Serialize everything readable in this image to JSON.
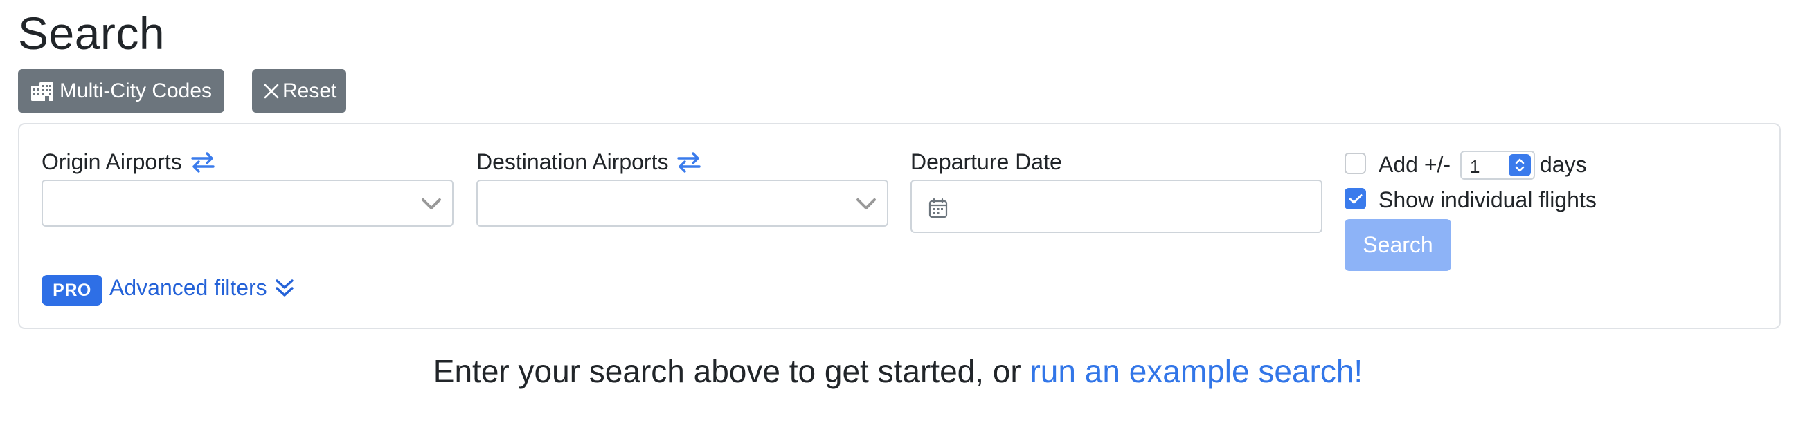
{
  "page": {
    "title": "Search"
  },
  "toolbar": {
    "multi_city_label": "Multi-City Codes",
    "multi_city_icon": "buildings-icon",
    "reset_label": "Reset",
    "reset_icon": "x-icon"
  },
  "form": {
    "origin_label": "Origin Airports",
    "destination_label": "Destination Airports",
    "swap_icon": "arrows-swap-icon",
    "origin_value": "",
    "destination_value": "",
    "departure_label": "Departure Date",
    "departure_value": "",
    "add_days_prefix": "Add +/-",
    "add_days_value": "1",
    "add_days_suffix": "days",
    "add_days_checked": false,
    "show_individual_label": "Show individual flights",
    "show_individual_checked": true,
    "search_button": "Search"
  },
  "advanced": {
    "badge": "PRO",
    "label": "Advanced filters"
  },
  "cta": {
    "text": "Enter your search above to get started, or",
    "link": "run an example search!"
  },
  "colors": {
    "primary": "#3a7bec",
    "secondary": "#6c757d",
    "search_disabled": "#8db3f7",
    "link": "#3276e8"
  }
}
